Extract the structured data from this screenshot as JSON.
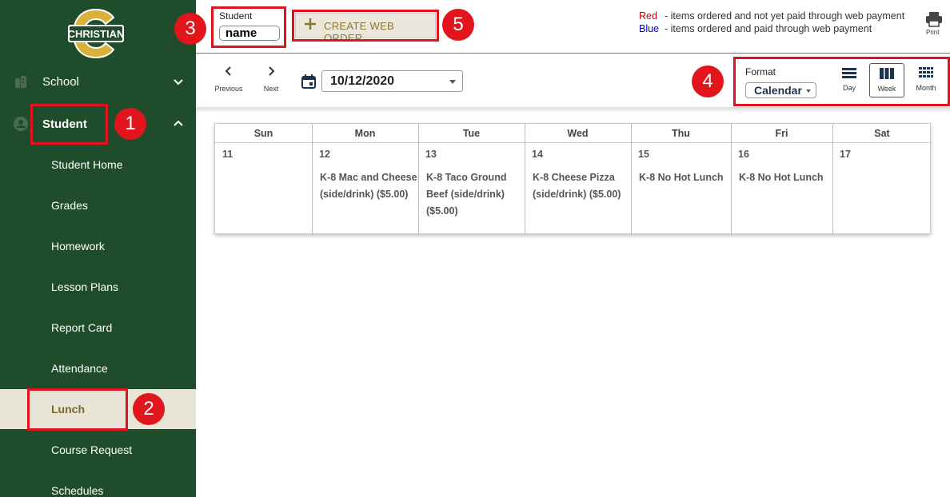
{
  "sidebar": {
    "logo_text": "CHRISTIAN",
    "logo_letter": "C",
    "sections": [
      {
        "label": "School",
        "icon": "building-icon",
        "expanded": false
      },
      {
        "label": "Student",
        "icon": "user-circle-icon",
        "expanded": true
      }
    ],
    "items": [
      {
        "label": "Student Home"
      },
      {
        "label": "Grades"
      },
      {
        "label": "Homework"
      },
      {
        "label": "Lesson Plans"
      },
      {
        "label": "Report Card"
      },
      {
        "label": "Attendance"
      },
      {
        "label": "Lunch",
        "active": true
      },
      {
        "label": "Course Request"
      },
      {
        "label": "Schedules"
      }
    ]
  },
  "header": {
    "student_label": "Student",
    "student_value": "name",
    "create_button": "CREATE WEB ORDER",
    "legend": [
      {
        "color_word": "Red",
        "color": "#d40000",
        "text": "- items ordered and not yet paid through web payment"
      },
      {
        "color_word": "Blue",
        "color": "#0000c8",
        "text": "- items ordered and paid through web payment"
      }
    ],
    "print_label": "Print"
  },
  "toolbar": {
    "previous_label": "Previous",
    "next_label": "Next",
    "date_value": "10/12/2020",
    "format_label": "Format",
    "format_value": "Calendar",
    "views": [
      {
        "label": "Day",
        "icon": "day-view-icon"
      },
      {
        "label": "Week",
        "icon": "week-view-icon",
        "selected": true
      },
      {
        "label": "Month",
        "icon": "month-view-icon"
      }
    ]
  },
  "annotations": [
    "1",
    "2",
    "3",
    "4",
    "5"
  ],
  "calendar": {
    "days": [
      {
        "name": "Sun",
        "date": "11",
        "item": ""
      },
      {
        "name": "Mon",
        "date": "12",
        "item": "K-8 Mac and Cheese (side/drink) ($5.00)"
      },
      {
        "name": "Tue",
        "date": "13",
        "item": "K-8 Taco Ground Beef (side/drink) ($5.00)"
      },
      {
        "name": "Wed",
        "date": "14",
        "item": "K-8 Cheese Pizza (side/drink) ($5.00)"
      },
      {
        "name": "Thu",
        "date": "15",
        "item": "K-8 No Hot Lunch"
      },
      {
        "name": "Fri",
        "date": "16",
        "item": "K-8 No Hot Lunch"
      },
      {
        "name": "Sat",
        "date": "17",
        "item": ""
      }
    ]
  },
  "colors": {
    "sidebar_bg": "#1f4d2b",
    "active_item_bg": "#e8e4d8",
    "accent_gold": "#8a7533",
    "annotation_red": "#e3151c"
  }
}
